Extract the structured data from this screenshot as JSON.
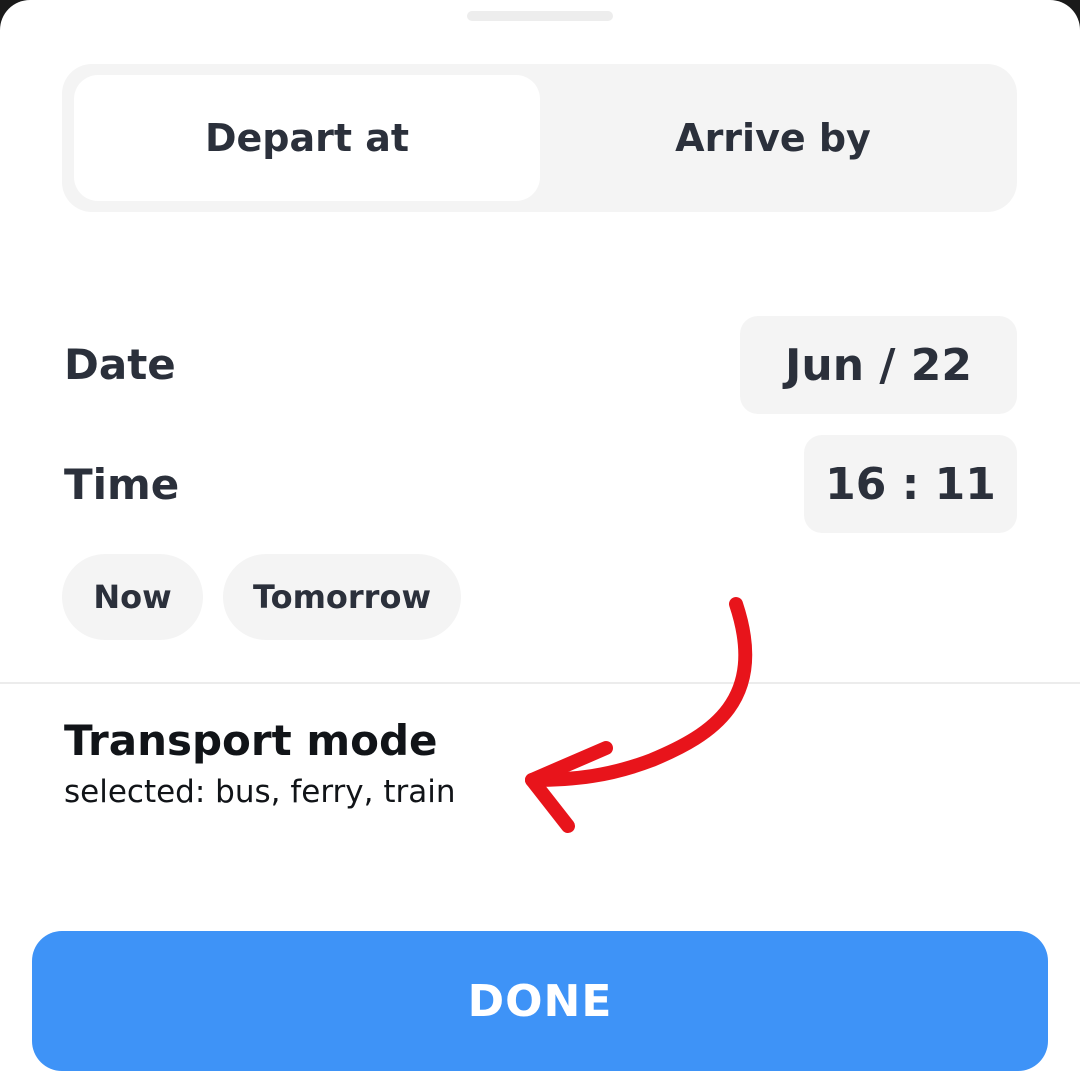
{
  "mode_selector": {
    "options": [
      "Depart at",
      "Arrive by"
    ],
    "selected": "Depart at"
  },
  "date_row": {
    "label": "Date",
    "value": "Jun / 22"
  },
  "time_row": {
    "label": "Time",
    "value": "16 : 11"
  },
  "quick_chips": [
    "Now",
    "Tomorrow"
  ],
  "transport": {
    "title": "Transport mode",
    "subtitle": "selected: bus, ferry, train"
  },
  "done_button": {
    "label": "DONE"
  },
  "colors": {
    "primary_button": "#3e93f7",
    "annotation_arrow": "#e8141b",
    "text_dark": "#2b303b",
    "surface_gray": "#f4f4f4"
  },
  "icons": {
    "annotation": "red-curved-arrow-icon"
  }
}
